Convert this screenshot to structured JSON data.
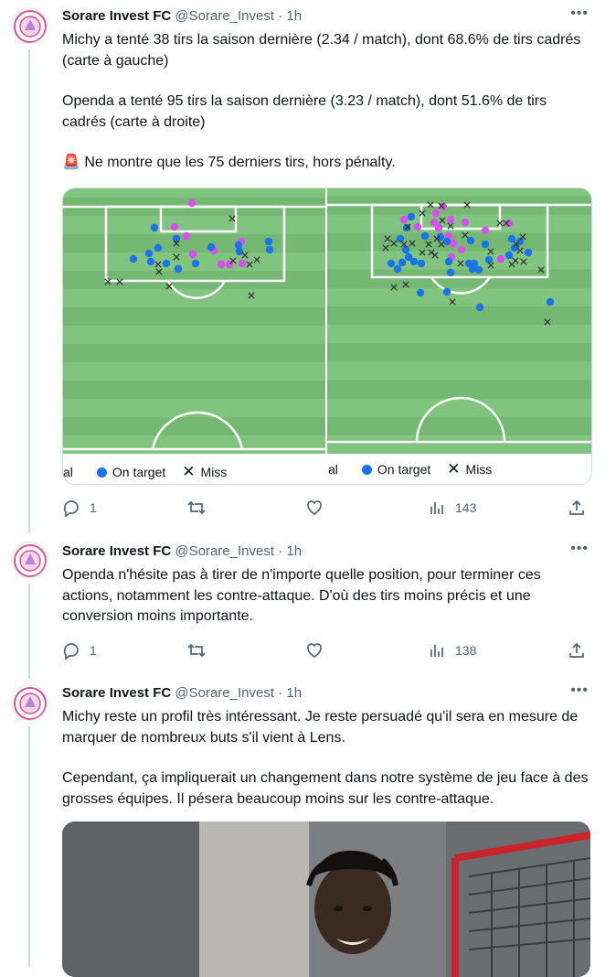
{
  "account": {
    "name": "Sorare Invest FC",
    "handle": "@Sorare_Invest",
    "time": "1h",
    "sep": "·"
  },
  "tweets": [
    {
      "paragraphs": [
        "Michy a tenté 38 tirs la saison dernière (2.34 / match), dont 68.6% de tirs cadrés (carte à gauche)",
        "Openda a tenté 95 tirs la saison dernière (3.23 / match), dont 51.6% de tirs cadrés (carte à droite)",
        "🚨 Ne montre que les 75 derniers tirs, hors pénalty."
      ],
      "replies": "1",
      "retweets": "",
      "likes": "",
      "views": "143"
    },
    {
      "paragraphs": [
        "Openda n'hésite pas à tirer de n'importe quelle position, pour terminer ces actions, notamment les contre-attaque. D'où des tirs moins précis et une conversion moins importante."
      ],
      "replies": "1",
      "retweets": "",
      "likes": "",
      "views": "138"
    },
    {
      "paragraphs": [
        "Michy reste un profil très intéressant. Je reste persuadé qu'il sera en mesure de marquer de nombreux buts s'il vient à Lens.",
        "Cependant, ça impliquerait un changement dans notre système de jeu face à des grosses équipes. Il pésera beaucoup moins sur les contre-attaque."
      ]
    }
  ],
  "legend": {
    "left_partial": "al",
    "right_partial": "al",
    "on_target": "On target",
    "miss": "Miss"
  },
  "colors": {
    "pitch_light": "#80c47f",
    "pitch_dark": "#74b874",
    "on_target": "#1a73e8",
    "goal": "#d84ef0",
    "miss": "#333333"
  }
}
